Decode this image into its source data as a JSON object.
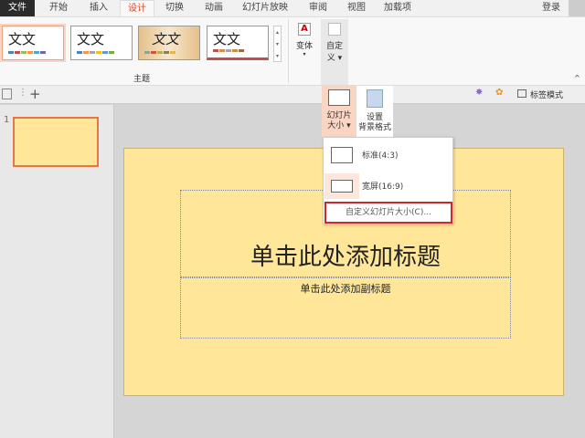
{
  "tabs": [
    "文件",
    "开始",
    "插入",
    "设计",
    "切换",
    "动画",
    "幻灯片放映",
    "审阅",
    "视图",
    "加载项"
  ],
  "active_tab": "设计",
  "login": "登录",
  "themes": {
    "group_label": "主题",
    "items": [
      {
        "text": "文文"
      },
      {
        "text": "文文"
      },
      {
        "text": "文文"
      },
      {
        "text": "文文"
      }
    ]
  },
  "variants": {
    "label": "变体"
  },
  "customize": {
    "label_line1": "自定",
    "label_line2": "义"
  },
  "slide_size": {
    "label_line1": "幻灯片",
    "label_line2": "大小"
  },
  "bg_format": {
    "label_line1": "设置",
    "label_line2": "背景格式"
  },
  "toolbar": {
    "tag_mode": "标签模式"
  },
  "thumbnail": {
    "number": "1"
  },
  "slide": {
    "title_placeholder": "单击此处添加标题",
    "subtitle_placeholder": "单击此处添加副标题"
  },
  "menu": {
    "items": [
      "标准(4:3)",
      "宽屏(16:9)"
    ],
    "custom": "自定义幻灯片大小(C)..."
  },
  "colors": {
    "accent": "#d24726",
    "slide_bg": "#ffe699",
    "highlight": "#fbd5c4"
  }
}
